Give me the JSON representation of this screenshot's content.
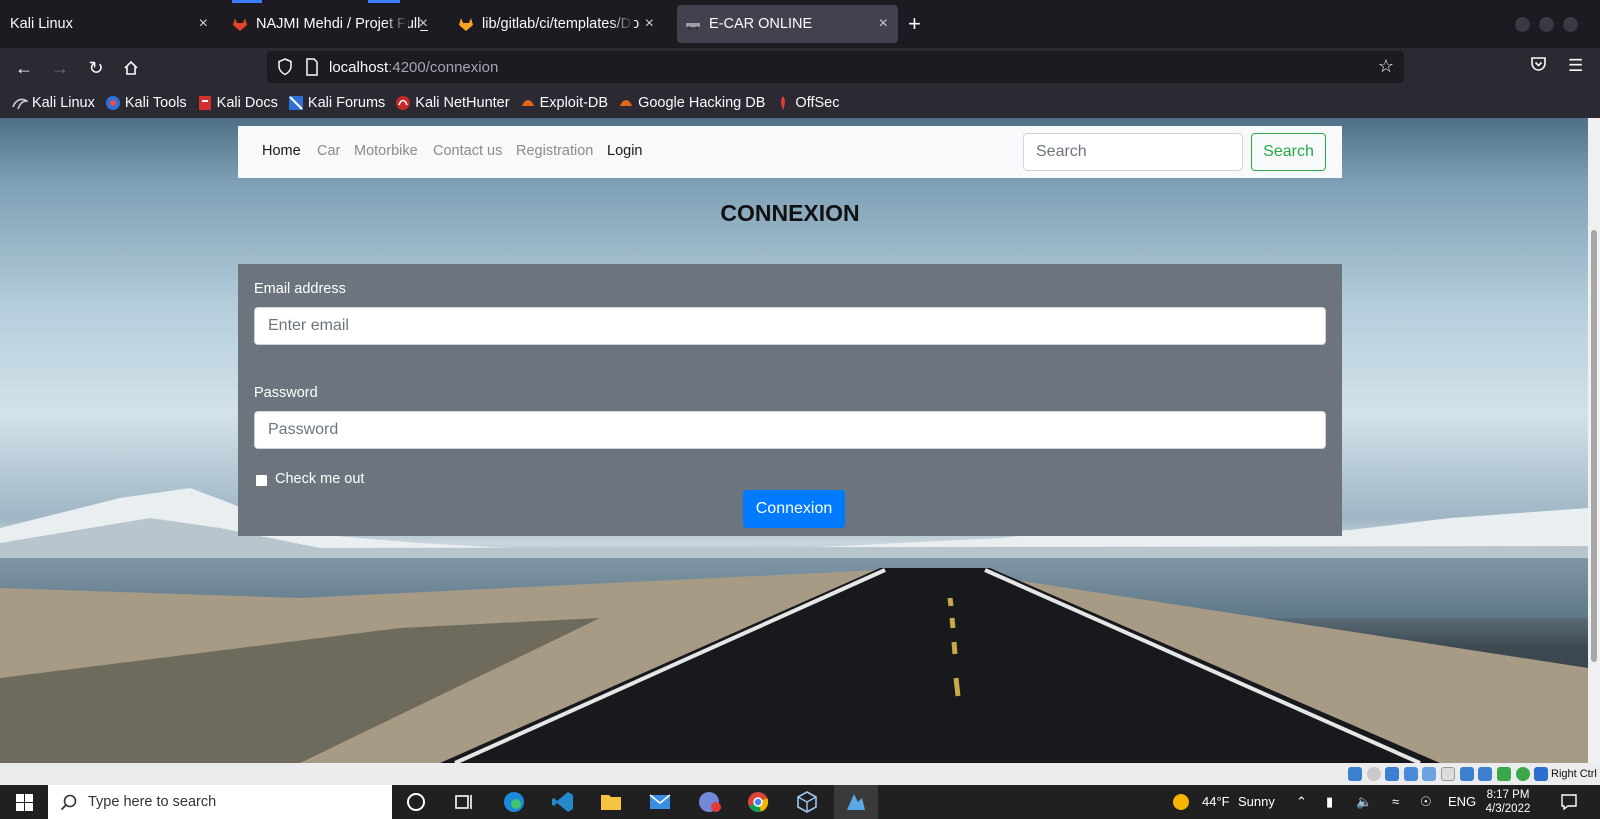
{
  "browser": {
    "tabs": [
      {
        "title": "Kali Linux",
        "active": false
      },
      {
        "title": "NAJMI Mehdi / Projet Full_",
        "active": false
      },
      {
        "title": "lib/gitlab/ci/templates/Do",
        "active": false
      },
      {
        "title": "E-CAR ONLINE",
        "active": true
      }
    ],
    "new_tab": "+",
    "close_glyph": "×",
    "url_host": "localhost",
    "url_rest": ":4200/connexion",
    "bookmarks": [
      "Kali Linux",
      "Kali Tools",
      "Kali Docs",
      "Kali Forums",
      "Kali NetHunter",
      "Exploit-DB",
      "Google Hacking DB",
      "OffSec"
    ]
  },
  "site": {
    "nav_links": [
      "Home",
      "Car",
      "Motorbike",
      "Contact us",
      "Registration",
      "Login"
    ],
    "search_placeholder": "Search",
    "search_button": "Search",
    "title": "CONNEXION",
    "form": {
      "email_label": "Email address",
      "email_placeholder": "Enter email",
      "password_label": "Password",
      "password_placeholder": "Password",
      "check_label": "Check me out",
      "submit_label": "Connexion"
    },
    "colors": {
      "primary": "#007bff",
      "success": "#28a745",
      "panel": "#6c757d"
    }
  },
  "vm": {
    "host_key": "Right Ctrl"
  },
  "taskbar": {
    "search_placeholder": "Type here to search",
    "weather_temp": "44°F",
    "weather_desc": "Sunny",
    "language": "ENG",
    "time": "8:17 PM",
    "date": "4/3/2022"
  }
}
